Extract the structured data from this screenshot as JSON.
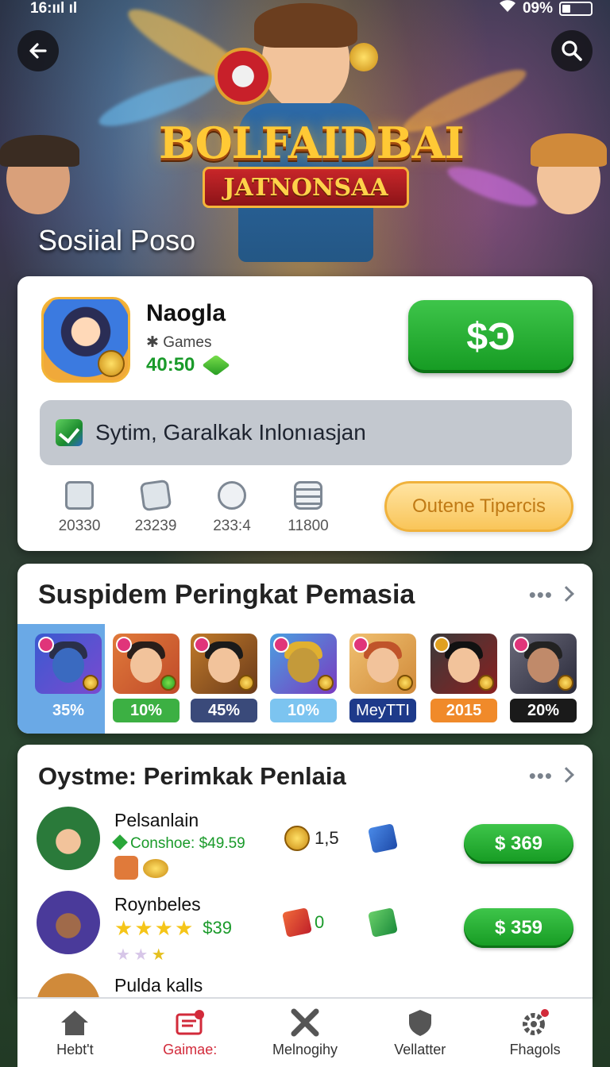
{
  "status_bar": {
    "time": "16:ııl ıl",
    "battery_text": "09%"
  },
  "header": {
    "back_icon": "arrow-left-icon",
    "search_icon": "search-icon",
    "logo_line1": "BOLFAIDBAI",
    "logo_line2": "JATNONSAA",
    "hero_title": "Sosiial Poso"
  },
  "app": {
    "name": "Naogla",
    "category": "✱ Games",
    "price": "40:50",
    "buy_label": "$Ͽ",
    "notice": "Sytim, Garalkak Inlonıasjan",
    "stats": [
      {
        "icon": "lock-icon",
        "value": "20330"
      },
      {
        "icon": "box-icon",
        "value": "23239"
      },
      {
        "icon": "magnifier-icon",
        "value": "233:4"
      },
      {
        "icon": "list-icon",
        "value": "11800"
      }
    ],
    "secondary_button": "Outene Tipercis"
  },
  "ranking": {
    "title": "Suspidem Peringkat Pemasia",
    "more": "•••",
    "items": [
      {
        "label": "35%",
        "color": "#6aa9e6",
        "text_color": "#ffffff"
      },
      {
        "label": "10%",
        "color": "#3cb043",
        "text_color": "#ffffff"
      },
      {
        "label": "45%",
        "color": "#3a4a7a",
        "text_color": "#ffffff"
      },
      {
        "label": "10%",
        "color": "#7cc4f0",
        "text_color": "#ffffff"
      },
      {
        "label": "MeyTTI",
        "color": "#1e3a8a",
        "text_color": "#ffffff"
      },
      {
        "label": "2015",
        "color": "#f08a2a",
        "text_color": "#ffffff"
      },
      {
        "label": "20%",
        "color": "#1a1a1a",
        "text_color": "#ffffff"
      }
    ]
  },
  "list": {
    "title": "Oystme: Perimkak Penlaia",
    "more": "•••",
    "items": [
      {
        "name": "Pelsanlain",
        "sub": "Conshoe: $49.59",
        "count": "1,5",
        "price": "$ 369"
      },
      {
        "name": "Roynbeles",
        "sub": "$39",
        "count": "0",
        "price": "$ 359"
      },
      {
        "name": "Pulda kalls"
      }
    ]
  },
  "nav": {
    "items": [
      {
        "label": "Hebt't",
        "icon": "home-icon"
      },
      {
        "label": "Gaimae:",
        "icon": "games-icon",
        "active": true
      },
      {
        "label": "Melnogihy",
        "icon": "tools-icon"
      },
      {
        "label": "Vellatter",
        "icon": "shield-icon"
      },
      {
        "label": "Fhagols",
        "icon": "gear-icon"
      }
    ]
  },
  "colors": {
    "accent_green": "#1a9a2a",
    "active_nav": "#d22a3a"
  }
}
